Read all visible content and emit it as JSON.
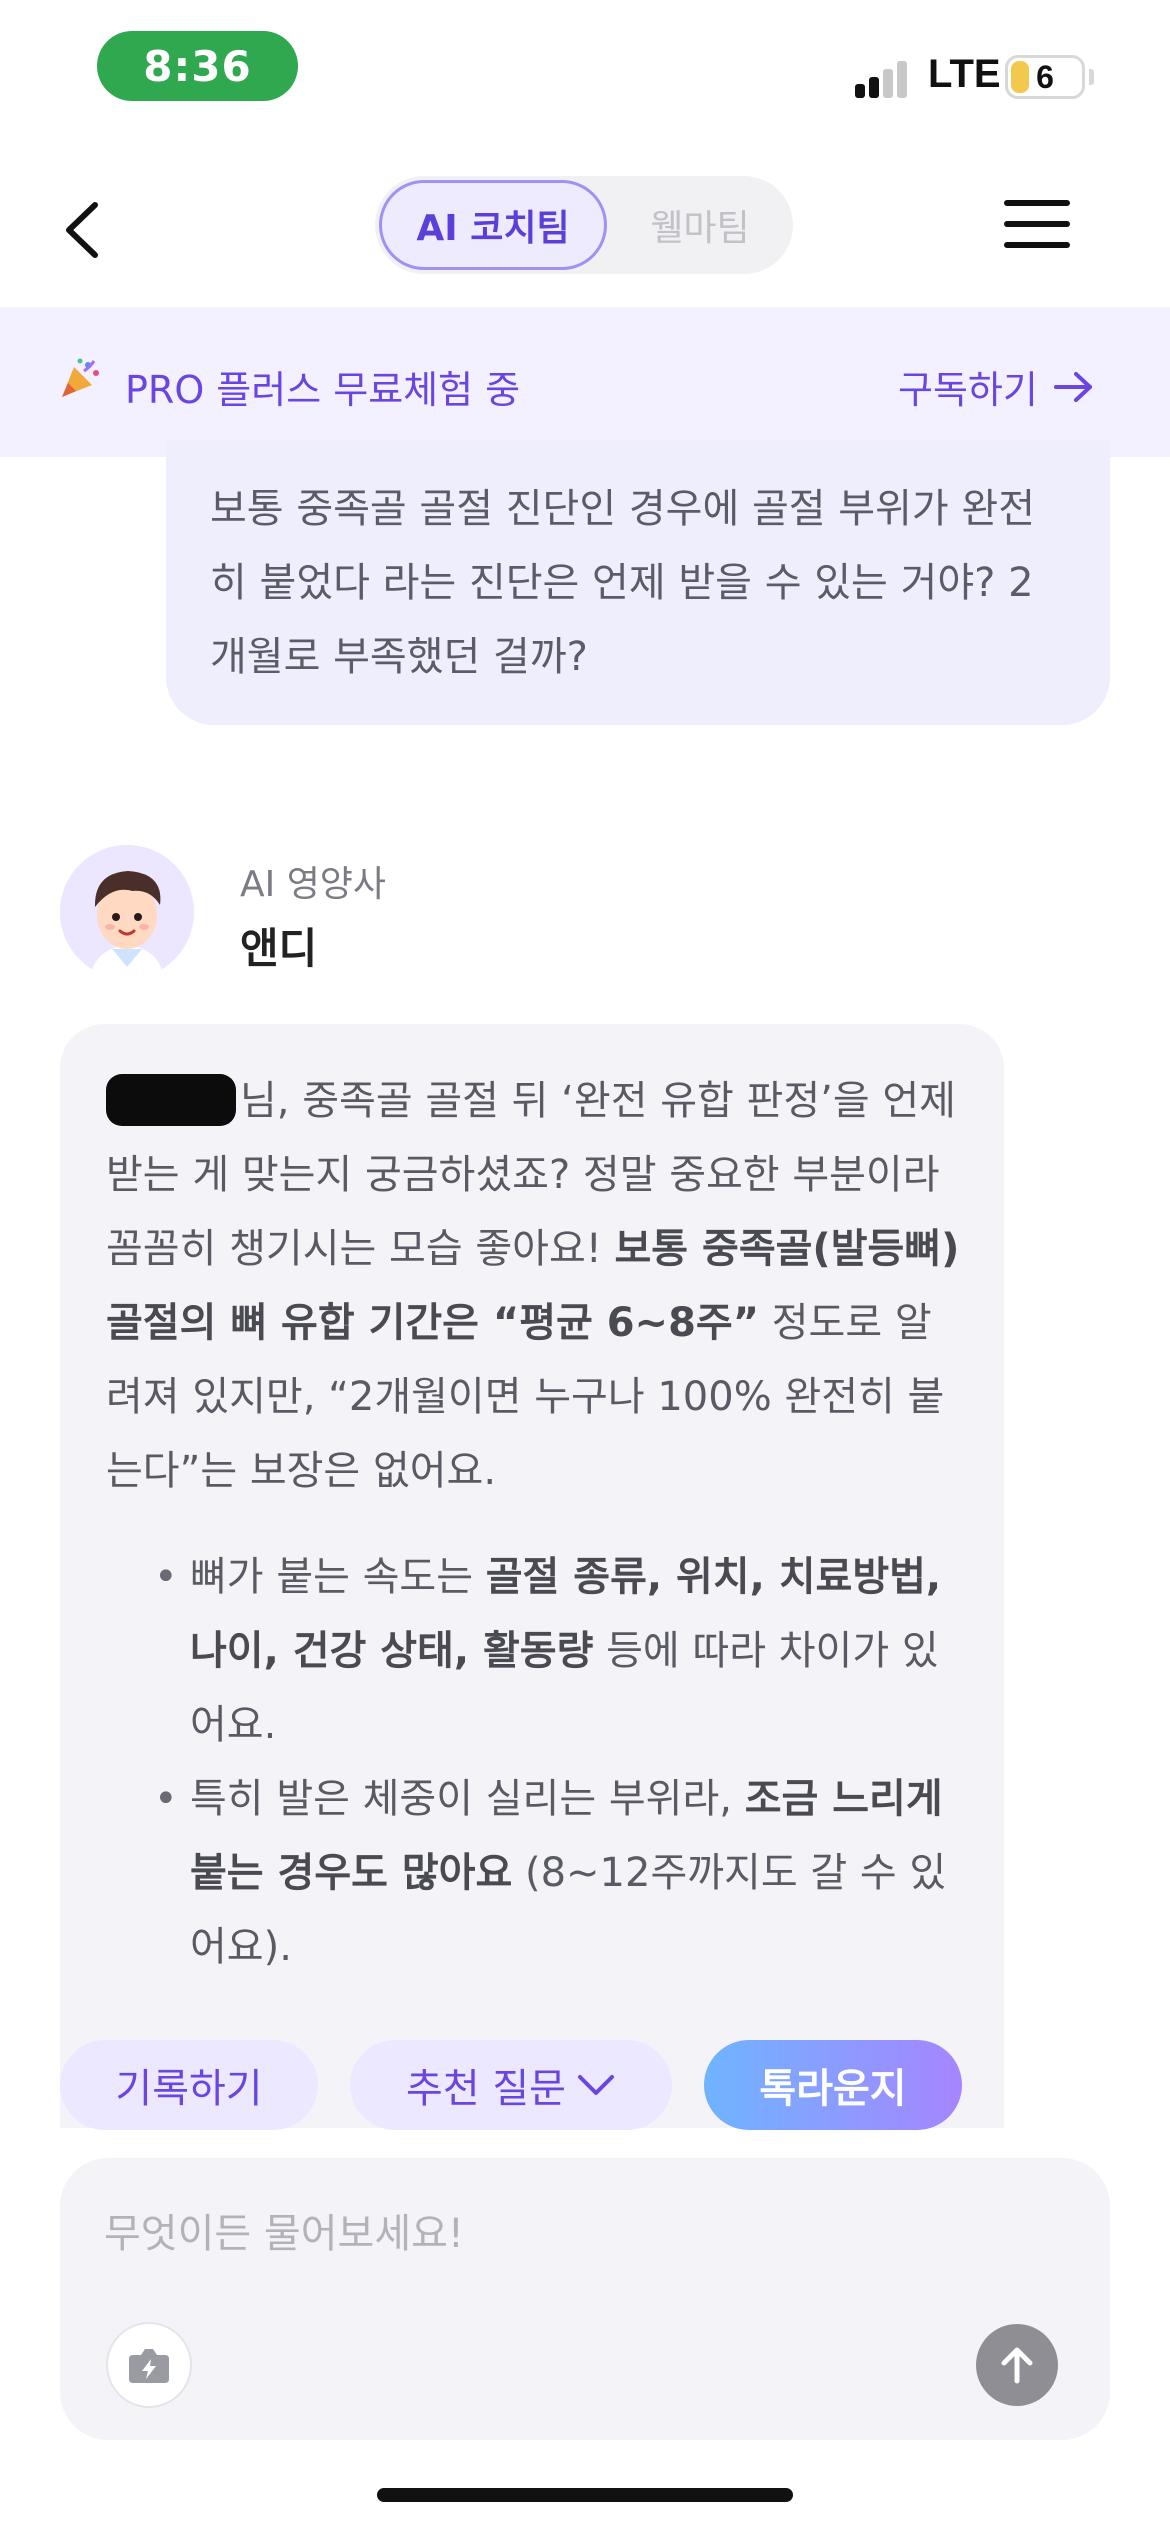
{
  "status_bar": {
    "time": "8:36",
    "network": "LTE",
    "battery": "6"
  },
  "header": {
    "tabs": [
      {
        "label": "AI 코치팀",
        "active": true
      },
      {
        "label": "웰마팀",
        "active": false
      }
    ],
    "icons": {
      "back": "chevron-left-icon",
      "menu": "hamburger-menu-icon"
    }
  },
  "promo": {
    "icon": "party-popper-icon",
    "text": "PRO 플러스 무료체험 중",
    "link": "구독하기",
    "link_icon": "arrow-right-icon"
  },
  "user_message": {
    "text": "보통 중족골 골절 진단인 경우에 골절 부위가 완전히 붙었다 라는 진단은 언제 받을 수 있는 거야? 2개월로 부족했던 걸까?"
  },
  "assistant": {
    "role": "AI 영양사",
    "name": "앤디",
    "para1": {
      "after_name": "님, 중족골 골절 뒤 ‘완전 유합 판정’을 언제 받는 게 맞는지 궁금하셨죠? 정말 중요한 부분이라 꼼꼼히 챙기시는 모습 좋아요!",
      "bold1": "보통 중족골(발등뼈) 골절의 뼈 유합 기간은 “평균 6~8주”",
      "text2": " 정도로 알려져 있지만, “2개월이면 누구나 100% 완전히 붙는다”는 보장은 없어요."
    },
    "bullet1": {
      "pre": "뼈가 붙는 속도는 ",
      "bold": "골절 종류, 위치, 치료방법, 나이, 건강 상태, 활동량",
      "post": " 등에 따라 차이가 있어요."
    },
    "bullet2": {
      "pre": "특히 발은 체중이 실리는 부위라, ",
      "bold": "조금 느리게 붙는 경우도 많아요",
      "post": " (8~12주까지도 갈 수 있어요)."
    }
  },
  "actions": {
    "record": "기록하기",
    "suggest": "추천 질문",
    "lounge": "톡라운지"
  },
  "input": {
    "placeholder": "무엇이든 물어보세요!",
    "camera_icon": "camera-icon",
    "send_icon": "arrow-up-icon"
  },
  "colors": {
    "accent": "#6a45e0",
    "accent_light": "#efebff",
    "status_green": "#2fa84f",
    "bubble_user": "#efeefc",
    "bubble_ai": "#f4f4f8"
  }
}
